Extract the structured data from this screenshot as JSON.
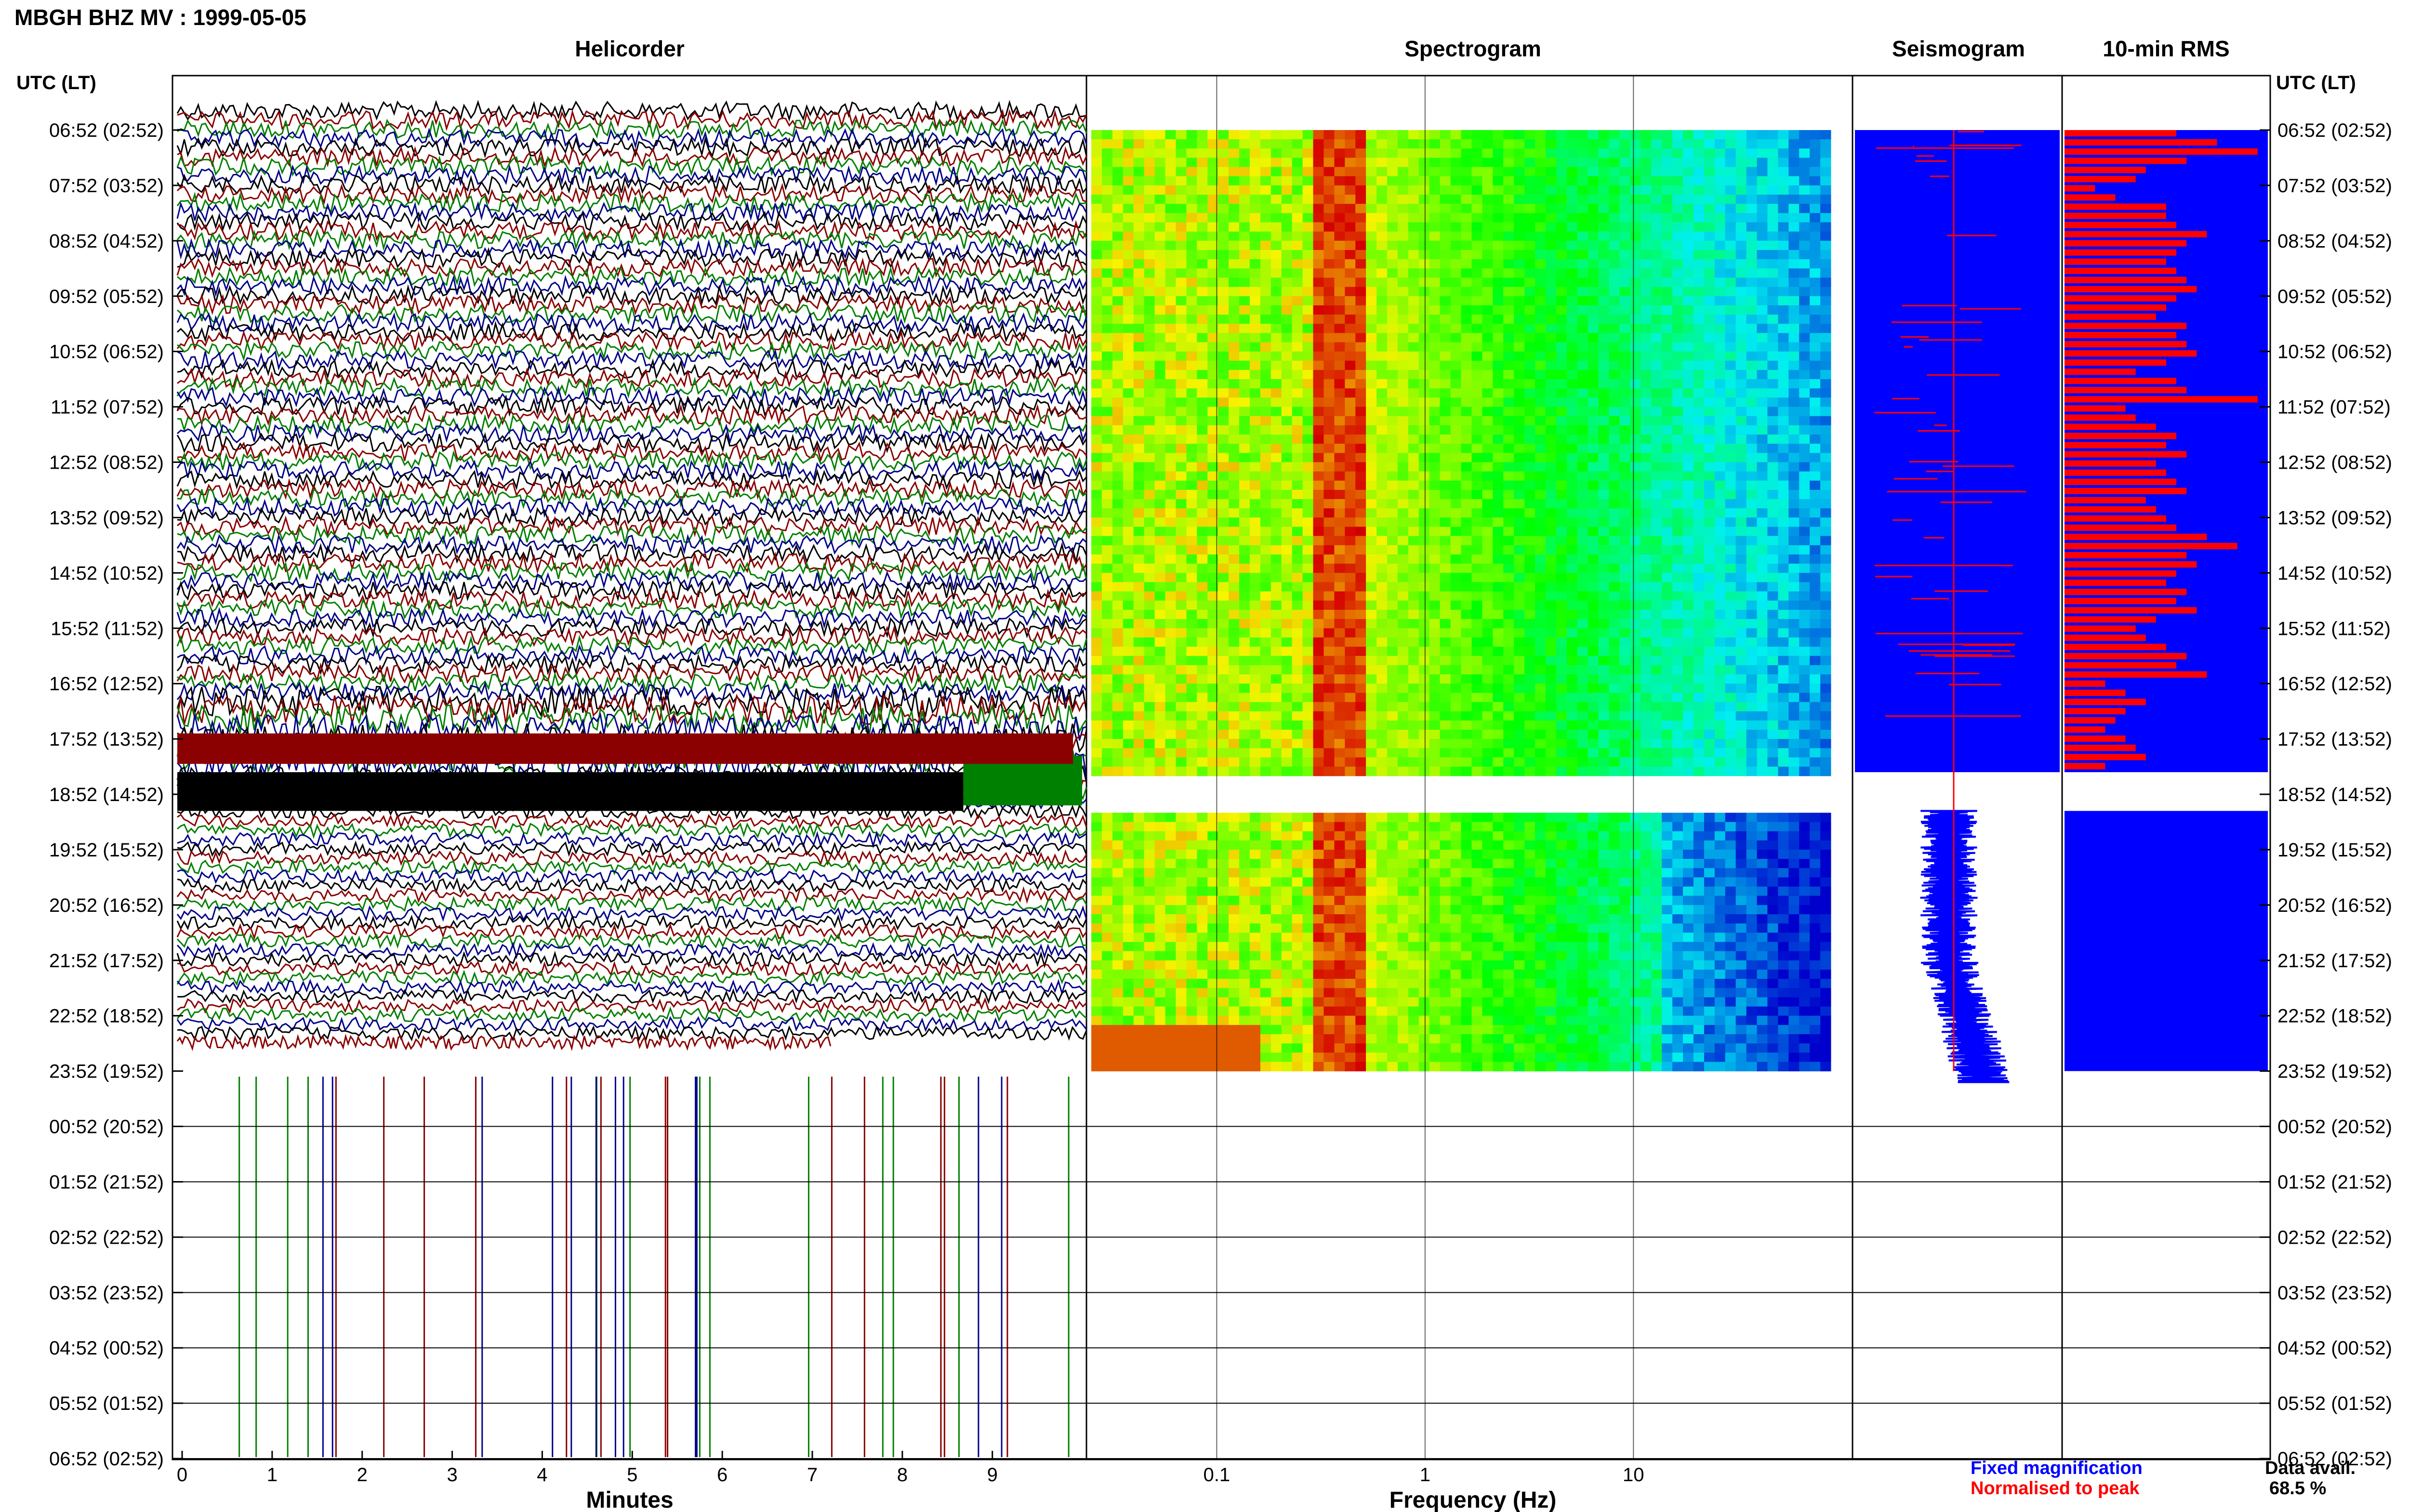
{
  "header": {
    "station_title": "MBGH BHZ MV : 1999-05-05",
    "utc_label_left": "UTC (LT)",
    "utc_label_right": "UTC (LT)"
  },
  "panels": {
    "helicorder_title": "Helicorder",
    "spectrogram_title": "Spectrogram",
    "seismogram_title": "Seismogram",
    "rms_title": "10-min RMS"
  },
  "axes": {
    "helicorder_xlabel": "Minutes",
    "spectrogram_xlabel": "Frequency (Hz)"
  },
  "legend": {
    "fixed": "Fixed magnification",
    "normalised": "Normalised to peak",
    "data_avail_label": "Data avail.",
    "data_avail_value": "68.5 %"
  },
  "colors": {
    "trace_colors": [
      "#000000",
      "#8b0000",
      "#008000",
      "#00008b"
    ],
    "seismogram_fixed": "#0000ff",
    "seismogram_normalised": "#ff0000",
    "rms_bar": "#ff0000",
    "rms_background": "#0000ff",
    "legend_fixed": "#0000ff",
    "legend_normalised": "#ff0000"
  },
  "chart_data": [
    {
      "type": "line",
      "name": "helicorder",
      "title": "Helicorder",
      "xlabel": "Minutes",
      "xlim": [
        0,
        10
      ],
      "x_ticks": [
        "0",
        "1",
        "2",
        "3",
        "4",
        "5",
        "6",
        "7",
        "8",
        "9"
      ],
      "y_ticks_left": [
        "06:52 (02:52)",
        "07:52 (03:52)",
        "08:52 (04:52)",
        "09:52 (05:52)",
        "10:52 (06:52)",
        "11:52 (07:52)",
        "12:52 (08:52)",
        "13:52 (09:52)",
        "14:52 (10:52)",
        "15:52 (11:52)",
        "16:52 (12:52)",
        "17:52 (13:52)",
        "18:52 (14:52)",
        "19:52 (15:52)",
        "20:52 (16:52)",
        "21:52 (17:52)",
        "22:52 (18:52)",
        "23:52 (19:52)",
        "00:52 (20:52)",
        "01:52 (21:52)",
        "02:52 (22:52)",
        "03:52 (23:52)",
        "04:52 (00:52)",
        "05:52 (01:52)",
        "06:52 (02:52)"
      ],
      "rows_per_hour": 6,
      "data_end_hour": 17,
      "grid": true
    },
    {
      "type": "heatmap",
      "name": "spectrogram",
      "title": "Spectrogram",
      "xlabel": "Frequency (Hz)",
      "x_scale": "log",
      "xlim": [
        0.025,
        50
      ],
      "x_ticks": [
        "0.1",
        "1",
        "10"
      ],
      "data_gap_hours": [
        11.6,
        12.3
      ],
      "data_end_hour": 17,
      "dominant_band_hz": [
        0.2,
        0.3
      ],
      "grid": true
    },
    {
      "type": "line",
      "name": "seismogram",
      "title": "Seismogram",
      "series": [
        {
          "name": "Fixed magnification",
          "color": "#0000ff"
        },
        {
          "name": "Normalised to peak",
          "color": "#ff0000"
        }
      ],
      "data_end_hour": 17
    },
    {
      "type": "bar",
      "name": "10-min RMS",
      "title": "10-min RMS",
      "orientation": "horizontal",
      "y_ticks_right": [
        "06:52 (02:52)",
        "07:52 (03:52)",
        "08:52 (04:52)",
        "09:52 (05:52)",
        "10:52 (06:52)",
        "11:52 (07:52)",
        "12:52 (08:52)",
        "13:52 (09:52)",
        "14:52 (10:52)",
        "15:52 (11:52)",
        "16:52 (12:52)",
        "17:52 (13:52)",
        "18:52 (14:52)",
        "19:52 (15:52)",
        "20:52 (16:52)",
        "21:52 (17:52)",
        "22:52 (18:52)",
        "23:52 (19:52)",
        "00:52 (20:52)",
        "01:52 (21:52)",
        "02:52 (22:52)",
        "03:52 (23:52)",
        "04:52 (00:52)",
        "05:52 (01:52)",
        "06:52 (02:52)"
      ],
      "values": [
        0.55,
        0.75,
        0.95,
        0.6,
        0.4,
        0.35,
        0.15,
        0.25,
        0.5,
        0.5,
        0.55,
        0.7,
        0.6,
        0.55,
        0.5,
        0.55,
        0.6,
        0.65,
        0.55,
        0.5,
        0.45,
        0.6,
        0.55,
        0.6,
        0.65,
        0.5,
        0.35,
        0.55,
        0.6,
        0.95,
        0.3,
        0.35,
        0.45,
        0.55,
        0.5,
        0.6,
        0.45,
        0.5,
        0.55,
        0.6,
        0.4,
        0.45,
        0.5,
        0.55,
        0.7,
        0.85,
        0.6,
        0.65,
        0.55,
        0.5,
        0.6,
        0.55,
        0.65,
        0.45,
        0.35,
        0.4,
        0.5,
        0.6,
        0.55,
        0.7,
        0.2,
        0.3,
        0.4,
        0.3,
        0.25,
        0.2,
        0.3,
        0.35,
        0.4,
        0.2
      ],
      "gap_hours": [
        11.6,
        12.3
      ]
    }
  ]
}
